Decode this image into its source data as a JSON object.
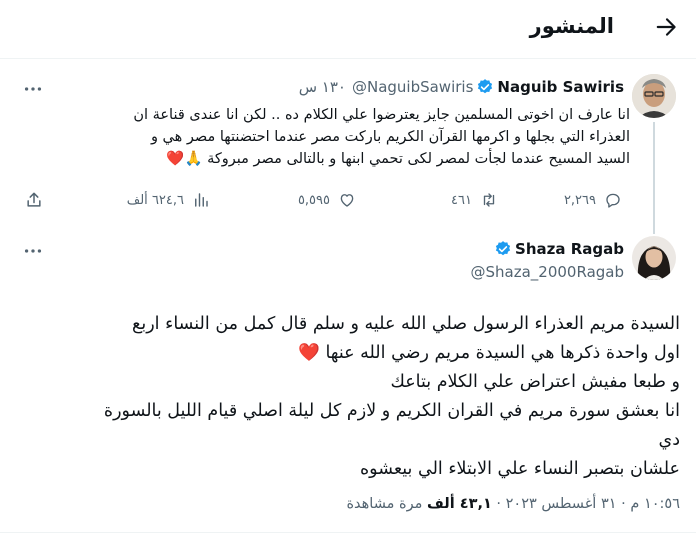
{
  "header": {
    "title": "المنشور"
  },
  "quoted_tweet": {
    "author_name": "Naguib Sawiris",
    "author_handle": "@NaguibSawiris",
    "time": "١٣٠ س",
    "lines": [
      "انا عارف ان اخوتى المسلمين جايز يعترضوا علي الكلام ده .. لكن انا عندى قناعة ان",
      "العذراء التي بجلها و اكرمها القرآن الكريم باركت مصر عندما احتضنتها مصر هي و",
      "السيد المسيح عندما لجأت لمصر لكى تحمي ابنها و بالتالى مصر مبروكة 🙏❤️"
    ],
    "stats": {
      "replies": "٢,٢٦٩",
      "retweets": "٤٦١",
      "likes": "٥,٥٩٥",
      "views": "٦٢٤,٦ ألف"
    }
  },
  "reply_tweet": {
    "author_name": "Shaza Ragab",
    "author_handle": "@Shaza_2000Ragab",
    "lines": [
      "السيدة مريم العذراء الرسول صلي الله عليه و سلم قال كمل من النساء اربع",
      "اول واحدة ذكرها هي السيدة مريم رضي الله عنها ❤️",
      "و طبعا مفيش اعتراض علي الكلام بتاعك",
      "انا بعشق سورة مريم في القران الكريم  و لازم كل ليلة اصلي قيام الليل بالسورة",
      "دي",
      "علشان بتصبر النساء علي الابتلاء الي بيعشوه"
    ],
    "time": "١٠:٥٦ م",
    "date": "٣١ أغسطس ٢٠٢٣",
    "views_count": "٤٣,١ ألف",
    "views_label": "مرة مشاهدة"
  },
  "colors": {
    "verified": "#1d9bf0",
    "heart": "#e0245e",
    "muted": "#536471"
  }
}
